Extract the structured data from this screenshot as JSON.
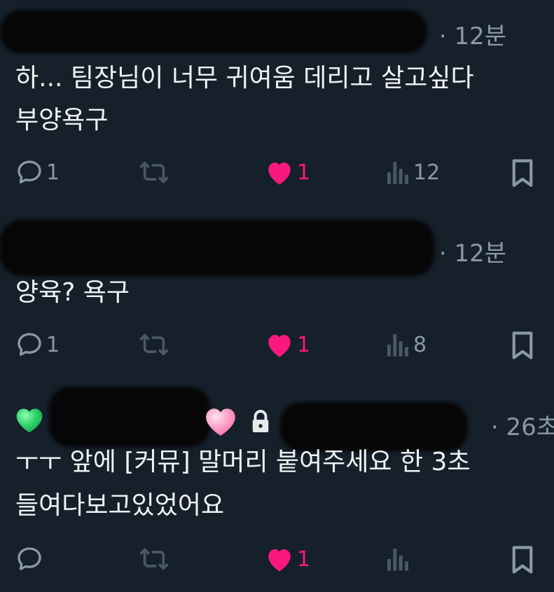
{
  "tweets": [
    {
      "meta": "· 12분",
      "lines": [
        "하... 팀장님이 너무 귀여움 데리고 살고싶다",
        "부양욕구"
      ],
      "replies": "1",
      "likes": "1",
      "views": "12"
    },
    {
      "meta": "· 12분",
      "lines": [
        "양육? 욕구"
      ],
      "replies": "1",
      "likes": "1",
      "views": "8"
    },
    {
      "meta": "· 26초",
      "lines": [
        "ㅜㅜ 앞에 [커뮤] 말머리 붙여주세요 한 3초",
        "들여다보고있었어요"
      ],
      "replies": "",
      "likes": "1",
      "views": ""
    }
  ],
  "icons": [
    "reply-icon",
    "retweet-icon",
    "like-icon",
    "views-icon",
    "bookmark-icon",
    "lock-icon",
    "green-heart-icon",
    "pink-heart-icon"
  ],
  "colors": {
    "background": "#15202b",
    "like": "#f91880",
    "muted": "#8b98a5",
    "text": "#e7e9ea"
  }
}
